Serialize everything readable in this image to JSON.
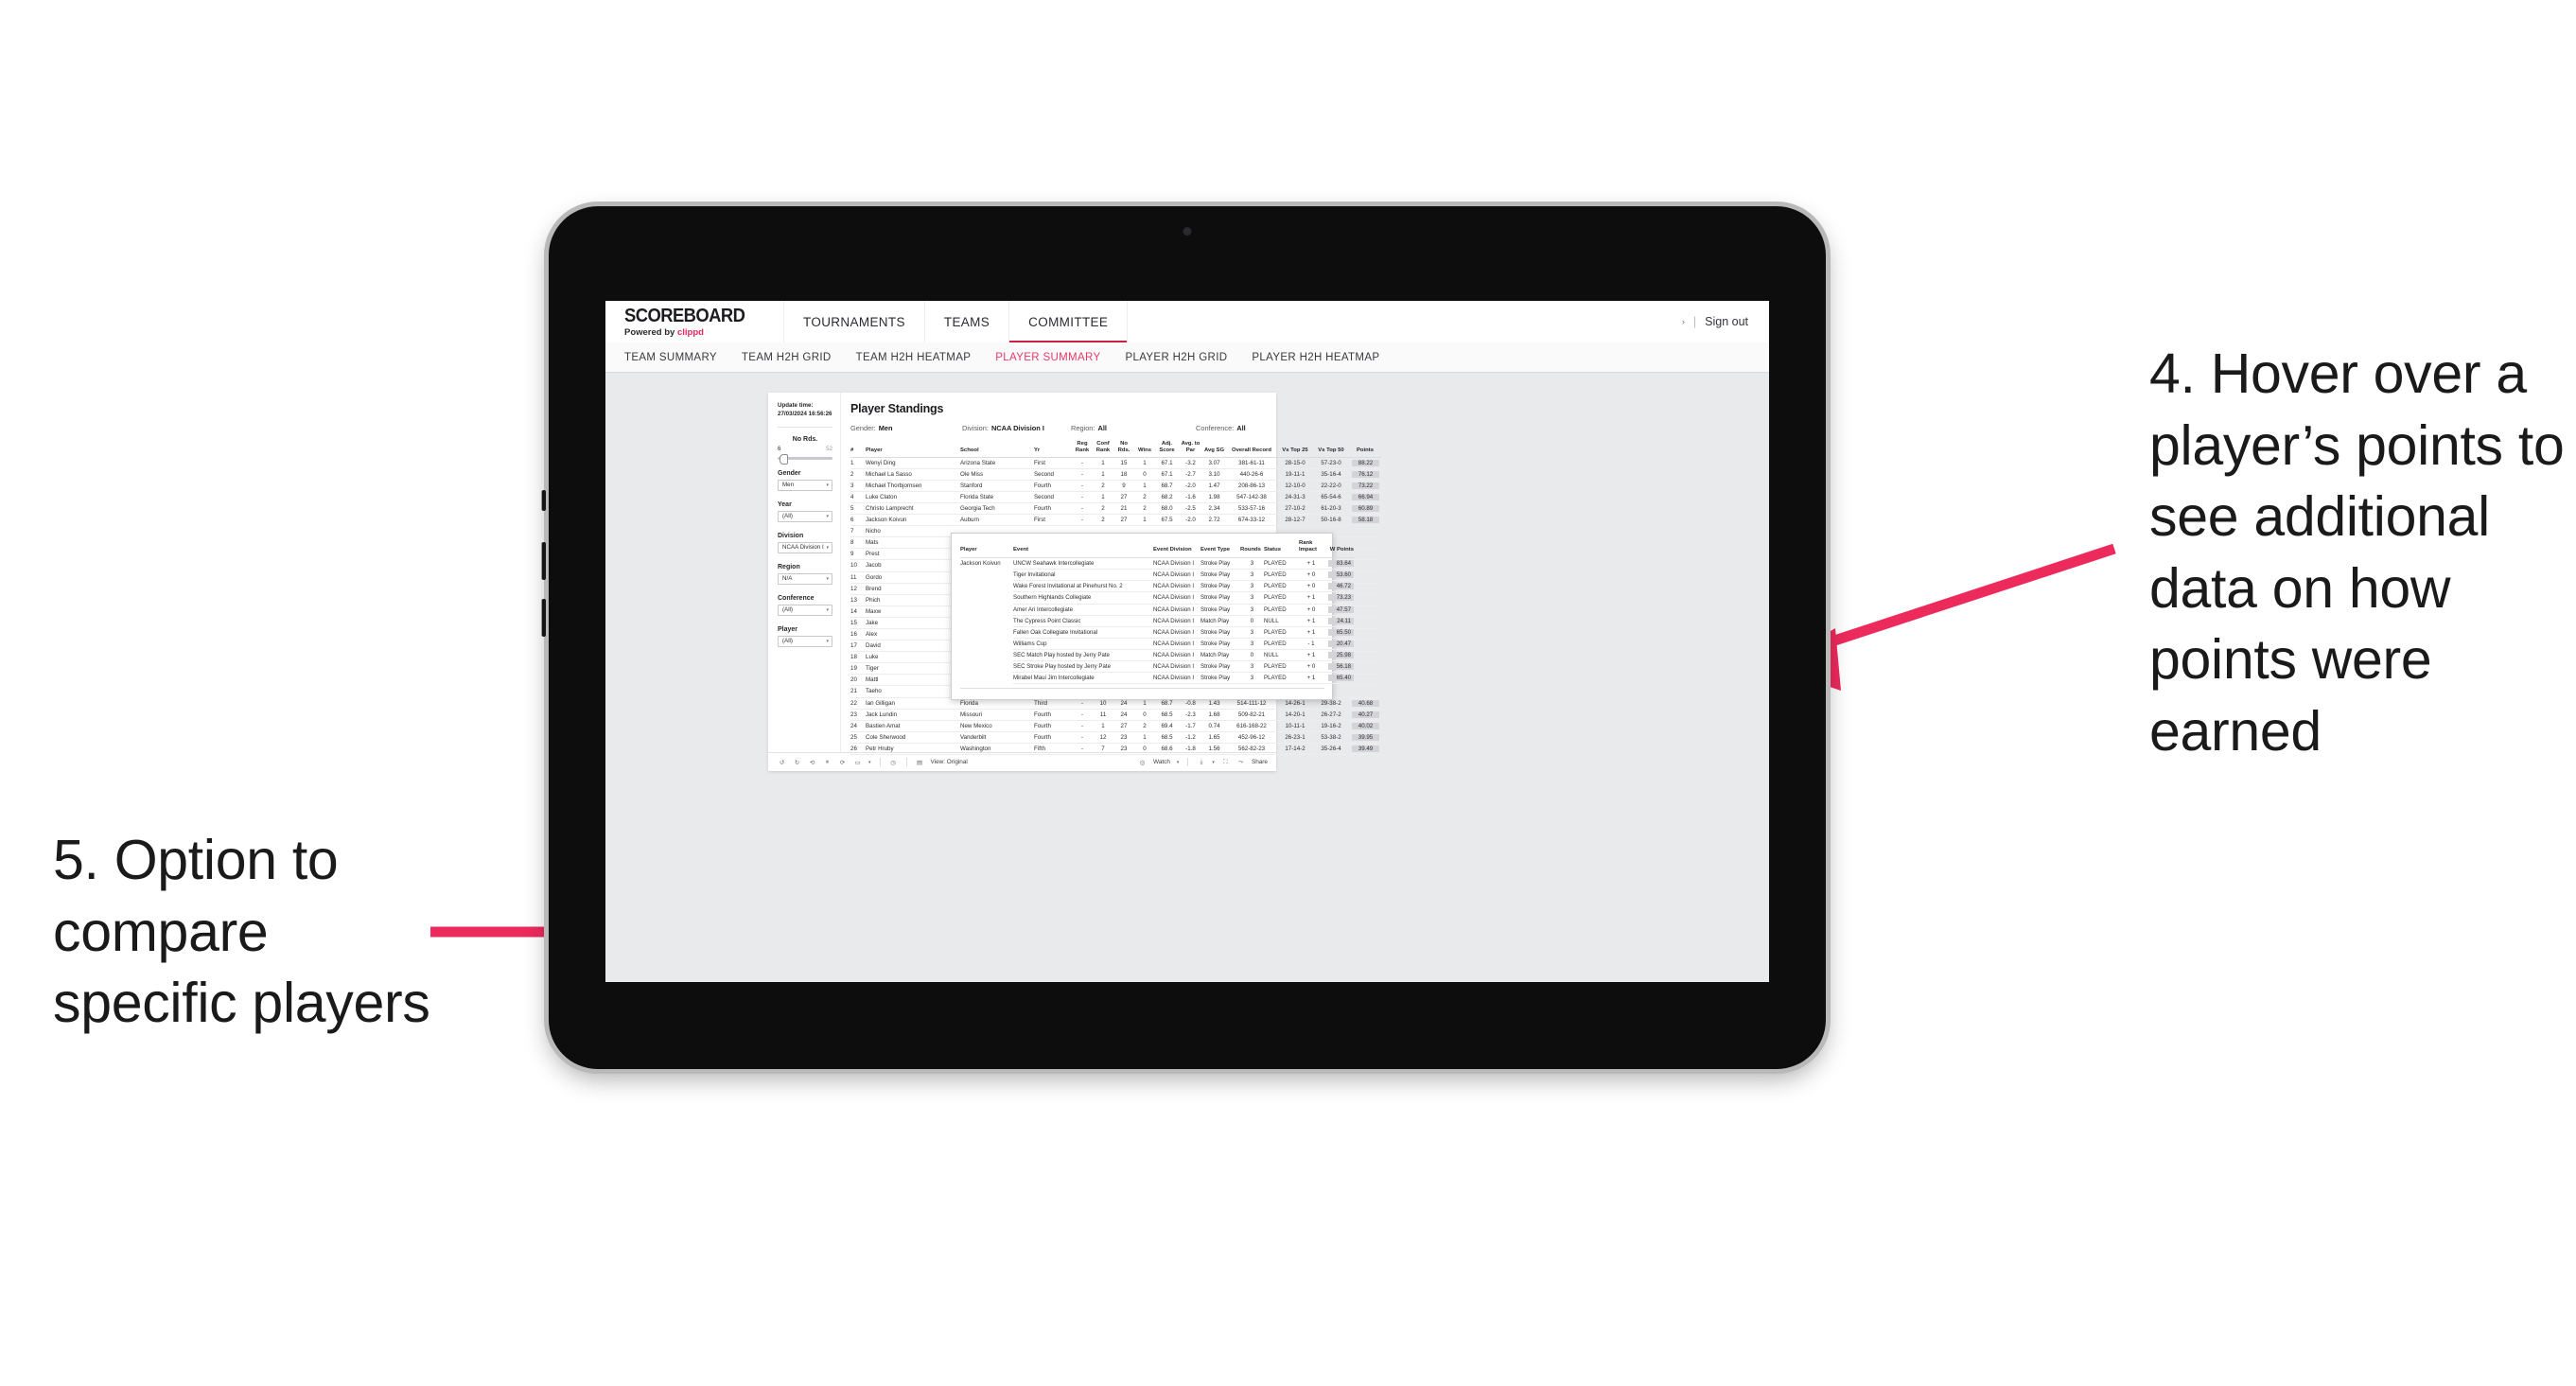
{
  "annotations": {
    "right": "4. Hover over a player’s points to see additional data on how points were earned",
    "left": "5. Option to compare specific players",
    "arrow_color": "#ED2A5C"
  },
  "topbar": {
    "brand_word": "SCOREBOARD",
    "brand_sub_prefix": "Powered by ",
    "brand_sub_accent": "clippd",
    "nav": [
      {
        "label": "TOURNAMENTS",
        "active": false
      },
      {
        "label": "TEAMS",
        "active": false
      },
      {
        "label": "COMMITTEE",
        "active": true
      }
    ],
    "caret": "›",
    "separator": "|",
    "signout": "Sign out",
    "accent": "#CF1F45"
  },
  "subtabs": [
    {
      "label": "TEAM SUMMARY",
      "active": false
    },
    {
      "label": "TEAM H2H GRID",
      "active": false
    },
    {
      "label": "TEAM H2H HEATMAP",
      "active": false
    },
    {
      "label": "PLAYER SUMMARY",
      "active": true
    },
    {
      "label": "PLAYER H2H GRID",
      "active": false
    },
    {
      "label": "PLAYER H2H HEATMAP",
      "active": false
    }
  ],
  "filters": {
    "update_label": "Update time:",
    "update_value": "27/03/2024 16:56:26",
    "slider": {
      "title": "No Rds.",
      "min": "6",
      "max": "52"
    },
    "groups": [
      {
        "label": "Gender",
        "value": "Men"
      },
      {
        "label": "Year",
        "value": "(All)"
      },
      {
        "label": "Division",
        "value": "NCAA Division I"
      },
      {
        "label": "Region",
        "value": "N/A"
      },
      {
        "label": "Conference",
        "value": "(All)"
      },
      {
        "label": "Player",
        "value": "(All)"
      }
    ],
    "caret": "▾"
  },
  "viz": {
    "title": "Player Standings",
    "meta": [
      {
        "key": "Gender:",
        "value": "Men"
      },
      {
        "key": "Division:",
        "value": "NCAA Division I"
      },
      {
        "key": "Region:",
        "value": "All"
      },
      {
        "key": "Conference:",
        "value": "All"
      }
    ],
    "columns": [
      "#",
      "Player",
      "School",
      "Yr",
      "Reg Rank",
      "Conf Rank",
      "No Rds.",
      "Wins",
      "Adj. Score",
      "Avg. to Par",
      "Avg SG",
      "Overall Record",
      "Vs Top 25",
      "Vs Top 50",
      "Points"
    ],
    "rows": [
      {
        "rank": "1",
        "player": "Wenyi Ding",
        "school": "Arizona State",
        "yr": "First",
        "reg": "-",
        "conf": "1",
        "rds": "15",
        "wins": "1",
        "adj": "67.1",
        "par": "-3.2",
        "sg": "3.07",
        "rec": "381-61-11",
        "t25": "28-15-0",
        "t50": "57-23-0",
        "pts": "88.22"
      },
      {
        "rank": "2",
        "player": "Michael La Sasso",
        "school": "Ole Miss",
        "yr": "Second",
        "reg": "-",
        "conf": "1",
        "rds": "18",
        "wins": "0",
        "adj": "67.1",
        "par": "-2.7",
        "sg": "3.10",
        "rec": "440-26-6",
        "t25": "19-11-1",
        "t50": "35-16-4",
        "pts": "76.12"
      },
      {
        "rank": "3",
        "player": "Michael Thorbjornsen",
        "school": "Stanford",
        "yr": "Fourth",
        "reg": "-",
        "conf": "2",
        "rds": "9",
        "wins": "1",
        "adj": "68.7",
        "par": "-2.0",
        "sg": "1.47",
        "rec": "208-86-13",
        "t25": "12-10-0",
        "t50": "22-22-0",
        "pts": "73.22"
      },
      {
        "rank": "4",
        "player": "Luke Claton",
        "school": "Florida State",
        "yr": "Second",
        "reg": "-",
        "conf": "1",
        "rds": "27",
        "wins": "2",
        "adj": "68.2",
        "par": "-1.6",
        "sg": "1.98",
        "rec": "547-142-38",
        "t25": "24-31-3",
        "t50": "65-54-6",
        "pts": "66.94"
      },
      {
        "rank": "5",
        "player": "Christo Lamprecht",
        "school": "Georgia Tech",
        "yr": "Fourth",
        "reg": "-",
        "conf": "2",
        "rds": "21",
        "wins": "2",
        "adj": "68.0",
        "par": "-2.5",
        "sg": "2.34",
        "rec": "533-57-16",
        "t25": "27-10-2",
        "t50": "61-20-3",
        "pts": "60.89"
      },
      {
        "rank": "6",
        "player": "Jackson Koivun",
        "school": "Auburn",
        "yr": "First",
        "reg": "-",
        "conf": "2",
        "rds": "27",
        "wins": "1",
        "adj": "67.5",
        "par": "-2.0",
        "sg": "2.72",
        "rec": "674-33-12",
        "t25": "28-12-7",
        "t50": "50-16-8",
        "pts": "58.18"
      },
      {
        "rank": "7",
        "player": "Nicho",
        "school": "",
        "yr": "",
        "reg": "",
        "conf": "",
        "rds": "",
        "wins": "",
        "adj": "",
        "par": "",
        "sg": "",
        "rec": "",
        "t25": "",
        "t50": "",
        "pts": ""
      },
      {
        "rank": "8",
        "player": "Mats",
        "school": "",
        "yr": "",
        "reg": "",
        "conf": "",
        "rds": "",
        "wins": "",
        "adj": "",
        "par": "",
        "sg": "",
        "rec": "",
        "t25": "",
        "t50": "",
        "pts": ""
      },
      {
        "rank": "9",
        "player": "Prest",
        "school": "",
        "yr": "",
        "reg": "",
        "conf": "",
        "rds": "",
        "wins": "",
        "adj": "",
        "par": "",
        "sg": "",
        "rec": "",
        "t25": "",
        "t50": "",
        "pts": ""
      },
      {
        "rank": "10",
        "player": "Jacob",
        "school": "",
        "yr": "",
        "reg": "",
        "conf": "",
        "rds": "",
        "wins": "",
        "adj": "",
        "par": "",
        "sg": "",
        "rec": "",
        "t25": "",
        "t50": "",
        "pts": ""
      },
      {
        "rank": "11",
        "player": "Gordo",
        "school": "",
        "yr": "",
        "reg": "",
        "conf": "",
        "rds": "",
        "wins": "",
        "adj": "",
        "par": "",
        "sg": "",
        "rec": "",
        "t25": "",
        "t50": "",
        "pts": ""
      },
      {
        "rank": "12",
        "player": "Brend",
        "school": "",
        "yr": "",
        "reg": "",
        "conf": "",
        "rds": "",
        "wins": "",
        "adj": "",
        "par": "",
        "sg": "",
        "rec": "",
        "t25": "",
        "t50": "",
        "pts": ""
      },
      {
        "rank": "13",
        "player": "Phich",
        "school": "",
        "yr": "",
        "reg": "",
        "conf": "",
        "rds": "",
        "wins": "",
        "adj": "",
        "par": "",
        "sg": "",
        "rec": "",
        "t25": "",
        "t50": "",
        "pts": ""
      },
      {
        "rank": "14",
        "player": "Maxw",
        "school": "",
        "yr": "",
        "reg": "",
        "conf": "",
        "rds": "",
        "wins": "",
        "adj": "",
        "par": "",
        "sg": "",
        "rec": "",
        "t25": "",
        "t50": "",
        "pts": ""
      },
      {
        "rank": "15",
        "player": "Jake",
        "school": "",
        "yr": "",
        "reg": "",
        "conf": "",
        "rds": "",
        "wins": "",
        "adj": "",
        "par": "",
        "sg": "",
        "rec": "",
        "t25": "",
        "t50": "",
        "pts": ""
      },
      {
        "rank": "16",
        "player": "Alex",
        "school": "",
        "yr": "",
        "reg": "",
        "conf": "",
        "rds": "",
        "wins": "",
        "adj": "",
        "par": "",
        "sg": "",
        "rec": "",
        "t25": "",
        "t50": "",
        "pts": ""
      },
      {
        "rank": "17",
        "player": "David",
        "school": "",
        "yr": "",
        "reg": "",
        "conf": "",
        "rds": "",
        "wins": "",
        "adj": "",
        "par": "",
        "sg": "",
        "rec": "",
        "t25": "",
        "t50": "",
        "pts": ""
      },
      {
        "rank": "18",
        "player": "Luke",
        "school": "",
        "yr": "",
        "reg": "",
        "conf": "",
        "rds": "",
        "wins": "",
        "adj": "",
        "par": "",
        "sg": "",
        "rec": "",
        "t25": "",
        "t50": "",
        "pts": ""
      },
      {
        "rank": "19",
        "player": "Tiger",
        "school": "",
        "yr": "",
        "reg": "",
        "conf": "",
        "rds": "",
        "wins": "",
        "adj": "",
        "par": "",
        "sg": "",
        "rec": "",
        "t25": "",
        "t50": "",
        "pts": ""
      },
      {
        "rank": "20",
        "player": "Mattl",
        "school": "",
        "yr": "",
        "reg": "",
        "conf": "",
        "rds": "",
        "wins": "",
        "adj": "",
        "par": "",
        "sg": "",
        "rec": "",
        "t25": "",
        "t50": "",
        "pts": ""
      },
      {
        "rank": "21",
        "player": "Taeho",
        "school": "",
        "yr": "",
        "reg": "",
        "conf": "",
        "rds": "",
        "wins": "",
        "adj": "",
        "par": "",
        "sg": "",
        "rec": "",
        "t25": "",
        "t50": "",
        "pts": ""
      },
      {
        "rank": "22",
        "player": "Ian Gilligan",
        "school": "Florida",
        "yr": "Third",
        "reg": "-",
        "conf": "10",
        "rds": "24",
        "wins": "1",
        "adj": "68.7",
        "par": "-0.8",
        "sg": "1.43",
        "rec": "514-111-12",
        "t25": "14-26-1",
        "t50": "29-38-2",
        "pts": "40.68"
      },
      {
        "rank": "23",
        "player": "Jack Lundin",
        "school": "Missouri",
        "yr": "Fourth",
        "reg": "-",
        "conf": "11",
        "rds": "24",
        "wins": "0",
        "adj": "68.5",
        "par": "-2.3",
        "sg": "1.68",
        "rec": "509-82-21",
        "t25": "14-20-1",
        "t50": "26-27-2",
        "pts": "40.27"
      },
      {
        "rank": "24",
        "player": "Bastien Amat",
        "school": "New Mexico",
        "yr": "Fourth",
        "reg": "-",
        "conf": "1",
        "rds": "27",
        "wins": "2",
        "adj": "69.4",
        "par": "-1.7",
        "sg": "0.74",
        "rec": "616-168-22",
        "t25": "10-11-1",
        "t50": "19-16-2",
        "pts": "40.02"
      },
      {
        "rank": "25",
        "player": "Cole Sherwood",
        "school": "Vanderbilt",
        "yr": "Fourth",
        "reg": "-",
        "conf": "12",
        "rds": "23",
        "wins": "1",
        "adj": "68.5",
        "par": "-1.2",
        "sg": "1.65",
        "rec": "452-96-12",
        "t25": "26-23-1",
        "t50": "53-38-2",
        "pts": "39.95"
      },
      {
        "rank": "26",
        "player": "Petr Hruby",
        "school": "Washington",
        "yr": "Fifth",
        "reg": "-",
        "conf": "7",
        "rds": "23",
        "wins": "0",
        "adj": "68.6",
        "par": "-1.8",
        "sg": "1.56",
        "rec": "562-82-23",
        "t25": "17-14-2",
        "t50": "35-26-4",
        "pts": "39.49"
      }
    ]
  },
  "tooltip": {
    "columns": [
      "Player",
      "Event",
      "Event Division",
      "Event Type",
      "Rounds",
      "Status",
      "Rank Impact",
      "W Points"
    ],
    "player": "Jackson Koivun",
    "rows": [
      {
        "event": "UNCW Seahawk Intercollegiate",
        "division": "NCAA Division I",
        "type": "Stroke Play",
        "rounds": "3",
        "status": "PLAYED",
        "impact": "+ 1",
        "wpoints": "83.64"
      },
      {
        "event": "Tiger Invitational",
        "division": "NCAA Division I",
        "type": "Stroke Play",
        "rounds": "3",
        "status": "PLAYED",
        "impact": "+ 0",
        "wpoints": "53.60"
      },
      {
        "event": "Wake Forest Invitational at Pinehurst No. 2",
        "division": "NCAA Division I",
        "type": "Stroke Play",
        "rounds": "3",
        "status": "PLAYED",
        "impact": "+ 0",
        "wpoints": "46.72"
      },
      {
        "event": "Southern Highlands Collegiate",
        "division": "NCAA Division I",
        "type": "Stroke Play",
        "rounds": "3",
        "status": "PLAYED",
        "impact": "+ 1",
        "wpoints": "73.23"
      },
      {
        "event": "Amer Ari Intercollegiate",
        "division": "NCAA Division I",
        "type": "Stroke Play",
        "rounds": "3",
        "status": "PLAYED",
        "impact": "+ 0",
        "wpoints": "47.57"
      },
      {
        "event": "The Cypress Point Classic",
        "division": "NCAA Division I",
        "type": "Match Play",
        "rounds": "0",
        "status": "NULL",
        "impact": "+ 1",
        "wpoints": "24.11"
      },
      {
        "event": "Fallen Oak Collegiate Invitational",
        "division": "NCAA Division I",
        "type": "Stroke Play",
        "rounds": "3",
        "status": "PLAYED",
        "impact": "+ 1",
        "wpoints": "65.50"
      },
      {
        "event": "Williams Cup",
        "division": "NCAA Division I",
        "type": "Stroke Play",
        "rounds": "3",
        "status": "PLAYED",
        "impact": "- 1",
        "wpoints": "20.47"
      },
      {
        "event": "SEC Match Play hosted by Jerry Pate",
        "division": "NCAA Division I",
        "type": "Match Play",
        "rounds": "0",
        "status": "NULL",
        "impact": "+ 1",
        "wpoints": "25.98"
      },
      {
        "event": "SEC Stroke Play hosted by Jerry Pate",
        "division": "NCAA Division I",
        "type": "Stroke Play",
        "rounds": "3",
        "status": "PLAYED",
        "impact": "+ 0",
        "wpoints": "56.18"
      },
      {
        "event": "Mirabel Maui Jim Intercollegiate",
        "division": "NCAA Division I",
        "type": "Stroke Play",
        "rounds": "3",
        "status": "PLAYED",
        "impact": "+ 1",
        "wpoints": "65.40"
      }
    ]
  },
  "toolbar": {
    "view_label": "View: Original",
    "watch_label": "Watch",
    "share_label": "Share",
    "caret": "▾"
  }
}
